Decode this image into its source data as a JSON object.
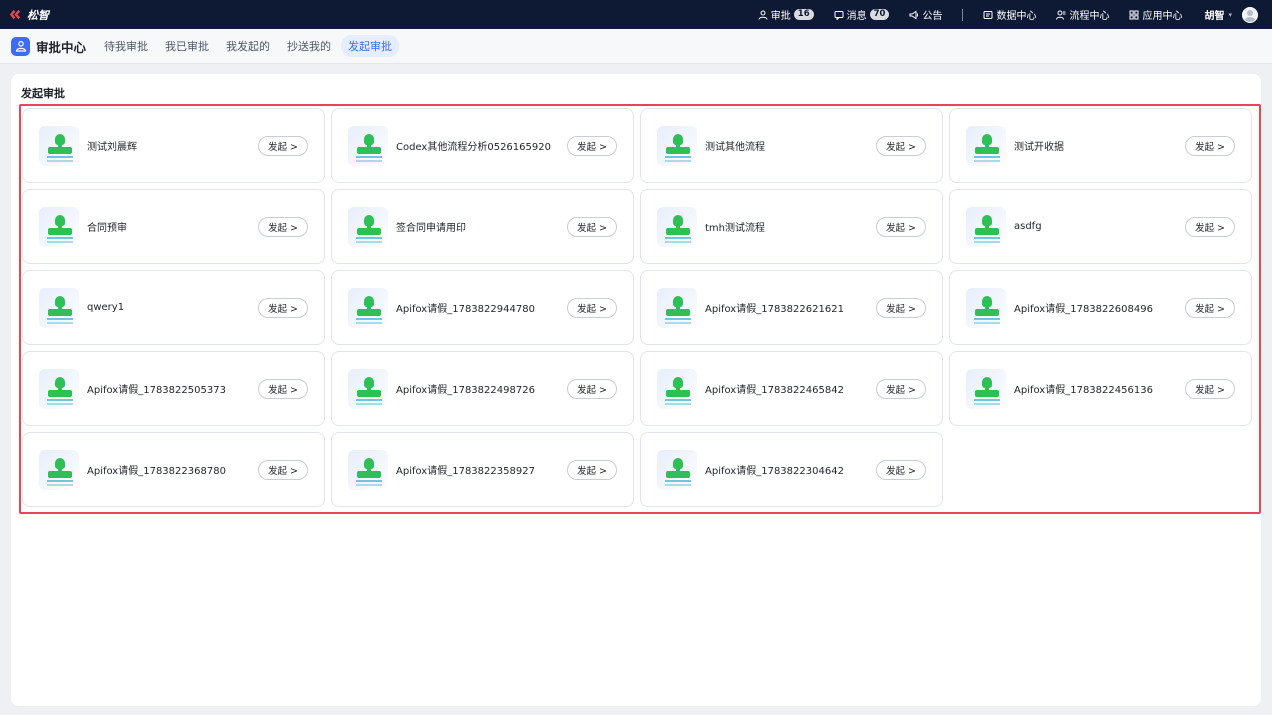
{
  "topbar": {
    "brand_name": "松智",
    "nav": [
      {
        "label": "审批",
        "badge": "16",
        "icon": "user-icon"
      },
      {
        "label": "消息",
        "badge": "70",
        "icon": "message-icon"
      },
      {
        "label": "公告",
        "badge": "",
        "icon": "megaphone-icon"
      },
      {
        "label": "数据中心",
        "badge": "",
        "icon": "database-icon"
      },
      {
        "label": "流程中心",
        "badge": "",
        "icon": "flow-icon"
      },
      {
        "label": "应用中心",
        "badge": "",
        "icon": "apps-icon"
      }
    ],
    "user_name": "胡智"
  },
  "subnav": {
    "module_title": "审批中心",
    "tabs": [
      {
        "label": "待我审批",
        "active": false
      },
      {
        "label": "我已审批",
        "active": false
      },
      {
        "label": "我发起的",
        "active": false
      },
      {
        "label": "抄送我的",
        "active": false
      },
      {
        "label": "发起审批",
        "active": true
      }
    ]
  },
  "main": {
    "section_title": "发起审批",
    "launch_label": "发起 >",
    "items": [
      "测试刘晨辉",
      "Codex其他流程分析0526165920",
      "测试其他流程",
      "测试开收据",
      "合同预审",
      "签合同申请用印",
      "tmh测试流程",
      "asdfg",
      "qwery1",
      "Apifox请假_1783822944780",
      "Apifox请假_1783822621621",
      "Apifox请假_1783822608496",
      "Apifox请假_1783822505373",
      "Apifox请假_1783822498726",
      "Apifox请假_1783822465842",
      "Apifox请假_1783822456136",
      "Apifox请假_1783822368780",
      "Apifox请假_1783822358927",
      "Apifox请假_1783822304642"
    ]
  },
  "colors": {
    "topbar_bg": "#0e1a34",
    "accent": "#3c6df0",
    "highlight_border": "#e5484d",
    "icon_green": "#2fbf57"
  }
}
